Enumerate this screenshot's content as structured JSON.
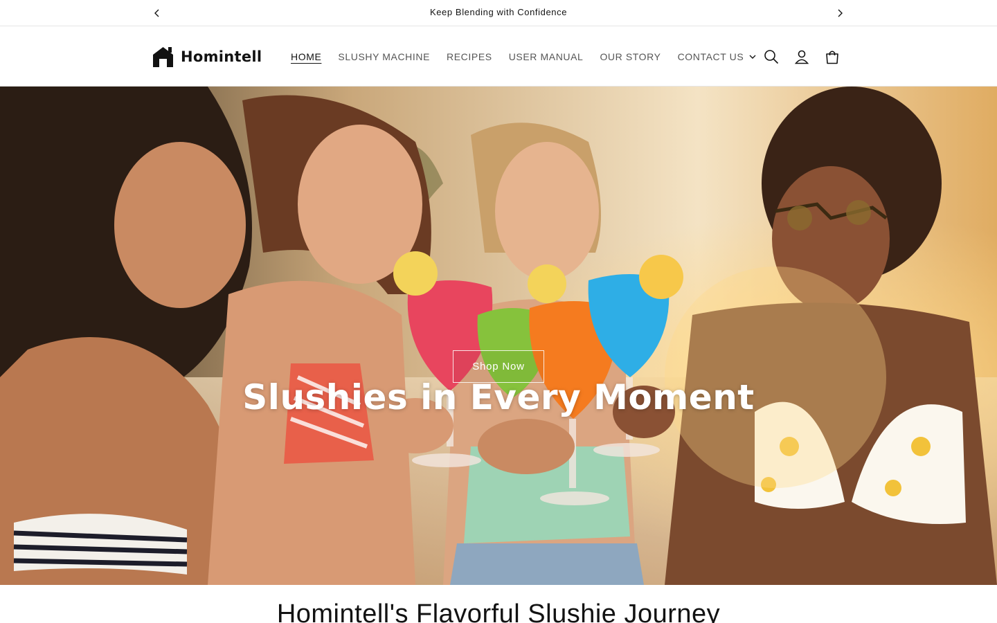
{
  "announcement": {
    "text": "Keep Blending with Confidence"
  },
  "header": {
    "logo_text": "Homintell",
    "nav": [
      {
        "label": "HOME"
      },
      {
        "label": "SLUSHY MACHINE"
      },
      {
        "label": "RECIPES"
      },
      {
        "label": "USER MANUAL"
      },
      {
        "label": "OUR STORY"
      },
      {
        "label": "CONTACT US"
      }
    ],
    "icons": [
      "search-icon",
      "account-icon",
      "cart-icon"
    ]
  },
  "hero": {
    "heading": "Slushies in Every Moment",
    "button_label": "Shop Now",
    "colors": {
      "pink": "#e8455e",
      "green": "#86c23c",
      "orange": "#f57b1f",
      "blue": "#2eaee6",
      "sun": "#ffd98a"
    }
  },
  "section": {
    "title": "Homintell's Flavorful Slushie Journey"
  }
}
